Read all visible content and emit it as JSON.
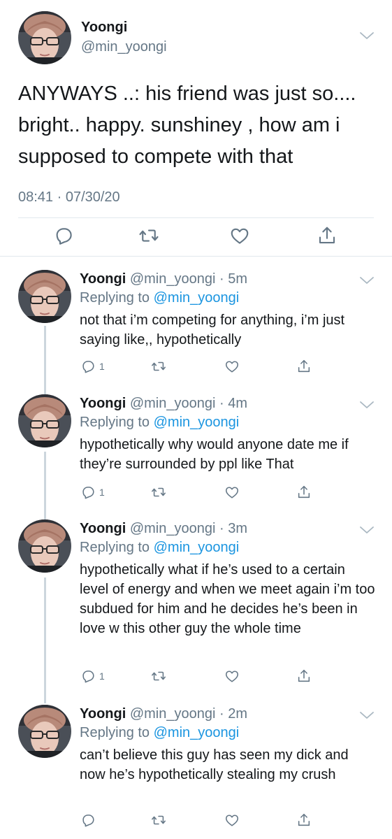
{
  "main_tweet": {
    "name": "Yoongi",
    "handle": "@min_yoongi",
    "text": "ANYWAYS ..: his friend was just so.... bright.. happy. sunshiney , how am i supposed to compete with that",
    "timestamp": "08:41 · 07/30/20"
  },
  "replies": [
    {
      "name": "Yoongi",
      "meta": "@min_yoongi · 5m",
      "replying_prefix": "Replying to ",
      "replying_to": "@min_yoongi",
      "text": "not that i’m competing for anything, i’m just saying like,, hypothetically",
      "reply_count": "1"
    },
    {
      "name": "Yoongi",
      "meta": "@min_yoongi · 4m",
      "replying_prefix": "Replying to ",
      "replying_to": "@min_yoongi",
      "text": "hypothetically why would anyone date me if they’re surrounded by ppl like That",
      "reply_count": "1"
    },
    {
      "name": "Yoongi",
      "meta": "@min_yoongi · 3m",
      "replying_prefix": "Replying to ",
      "replying_to": "@min_yoongi",
      "text": "hypothetically what if he’s used to a certain level of energy and when we meet again i’m too subdued for him and he decides he’s been in love w this other guy the whole time",
      "reply_count": "1"
    },
    {
      "name": "Yoongi",
      "meta": "@min_yoongi · 2m",
      "replying_prefix": "Replying to ",
      "replying_to": "@min_yoongi",
      "text": "can’t believe this guy has seen my dick and now he’s hypothetically stealing my crush",
      "reply_count": ""
    }
  ],
  "icons": [
    "reply-icon",
    "retweet-icon",
    "like-icon",
    "share-icon",
    "chevron-down-icon"
  ],
  "colors": {
    "link": "#1b95e0",
    "secondary": "#657786",
    "divider": "#e1e8ed",
    "thread_line": "#ccd6dd"
  }
}
